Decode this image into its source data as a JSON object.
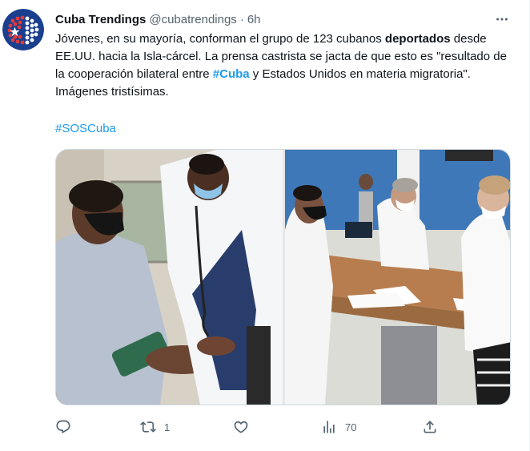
{
  "author": {
    "name": "Cuba Trendings",
    "handle": "@cubatrendings",
    "separator": "·",
    "time": "6h"
  },
  "tweet": {
    "parts": [
      {
        "text": "Jóvenes, en su mayoría, conforman el grupo de 123 cubanos ",
        "style": "normal"
      },
      {
        "text": "deportados",
        "style": "bold"
      },
      {
        "text": " desde EE.UU. hacia la Isla-cárcel. La prensa castrista se jacta de que esto es \"resultado de la cooperación bilateral entre ",
        "style": "normal"
      },
      {
        "text": "#Cuba",
        "style": "tag"
      },
      {
        "text": " y Estados Unidos en materia migratoria\". Imágenes tristísimas.",
        "style": "normal"
      }
    ],
    "hashtag": "#SOSCuba"
  },
  "actions": {
    "reply_count": "",
    "retweet_count": "1",
    "like_count": "",
    "views_count": "70"
  },
  "icons": [
    "more-icon",
    "reply-icon",
    "retweet-icon",
    "like-icon",
    "views-icon",
    "share-icon"
  ],
  "colors": {
    "link": "#1d9bf0",
    "muted": "#536471",
    "text": "#0f1419",
    "avatar_bg": "#1a3f8f"
  }
}
